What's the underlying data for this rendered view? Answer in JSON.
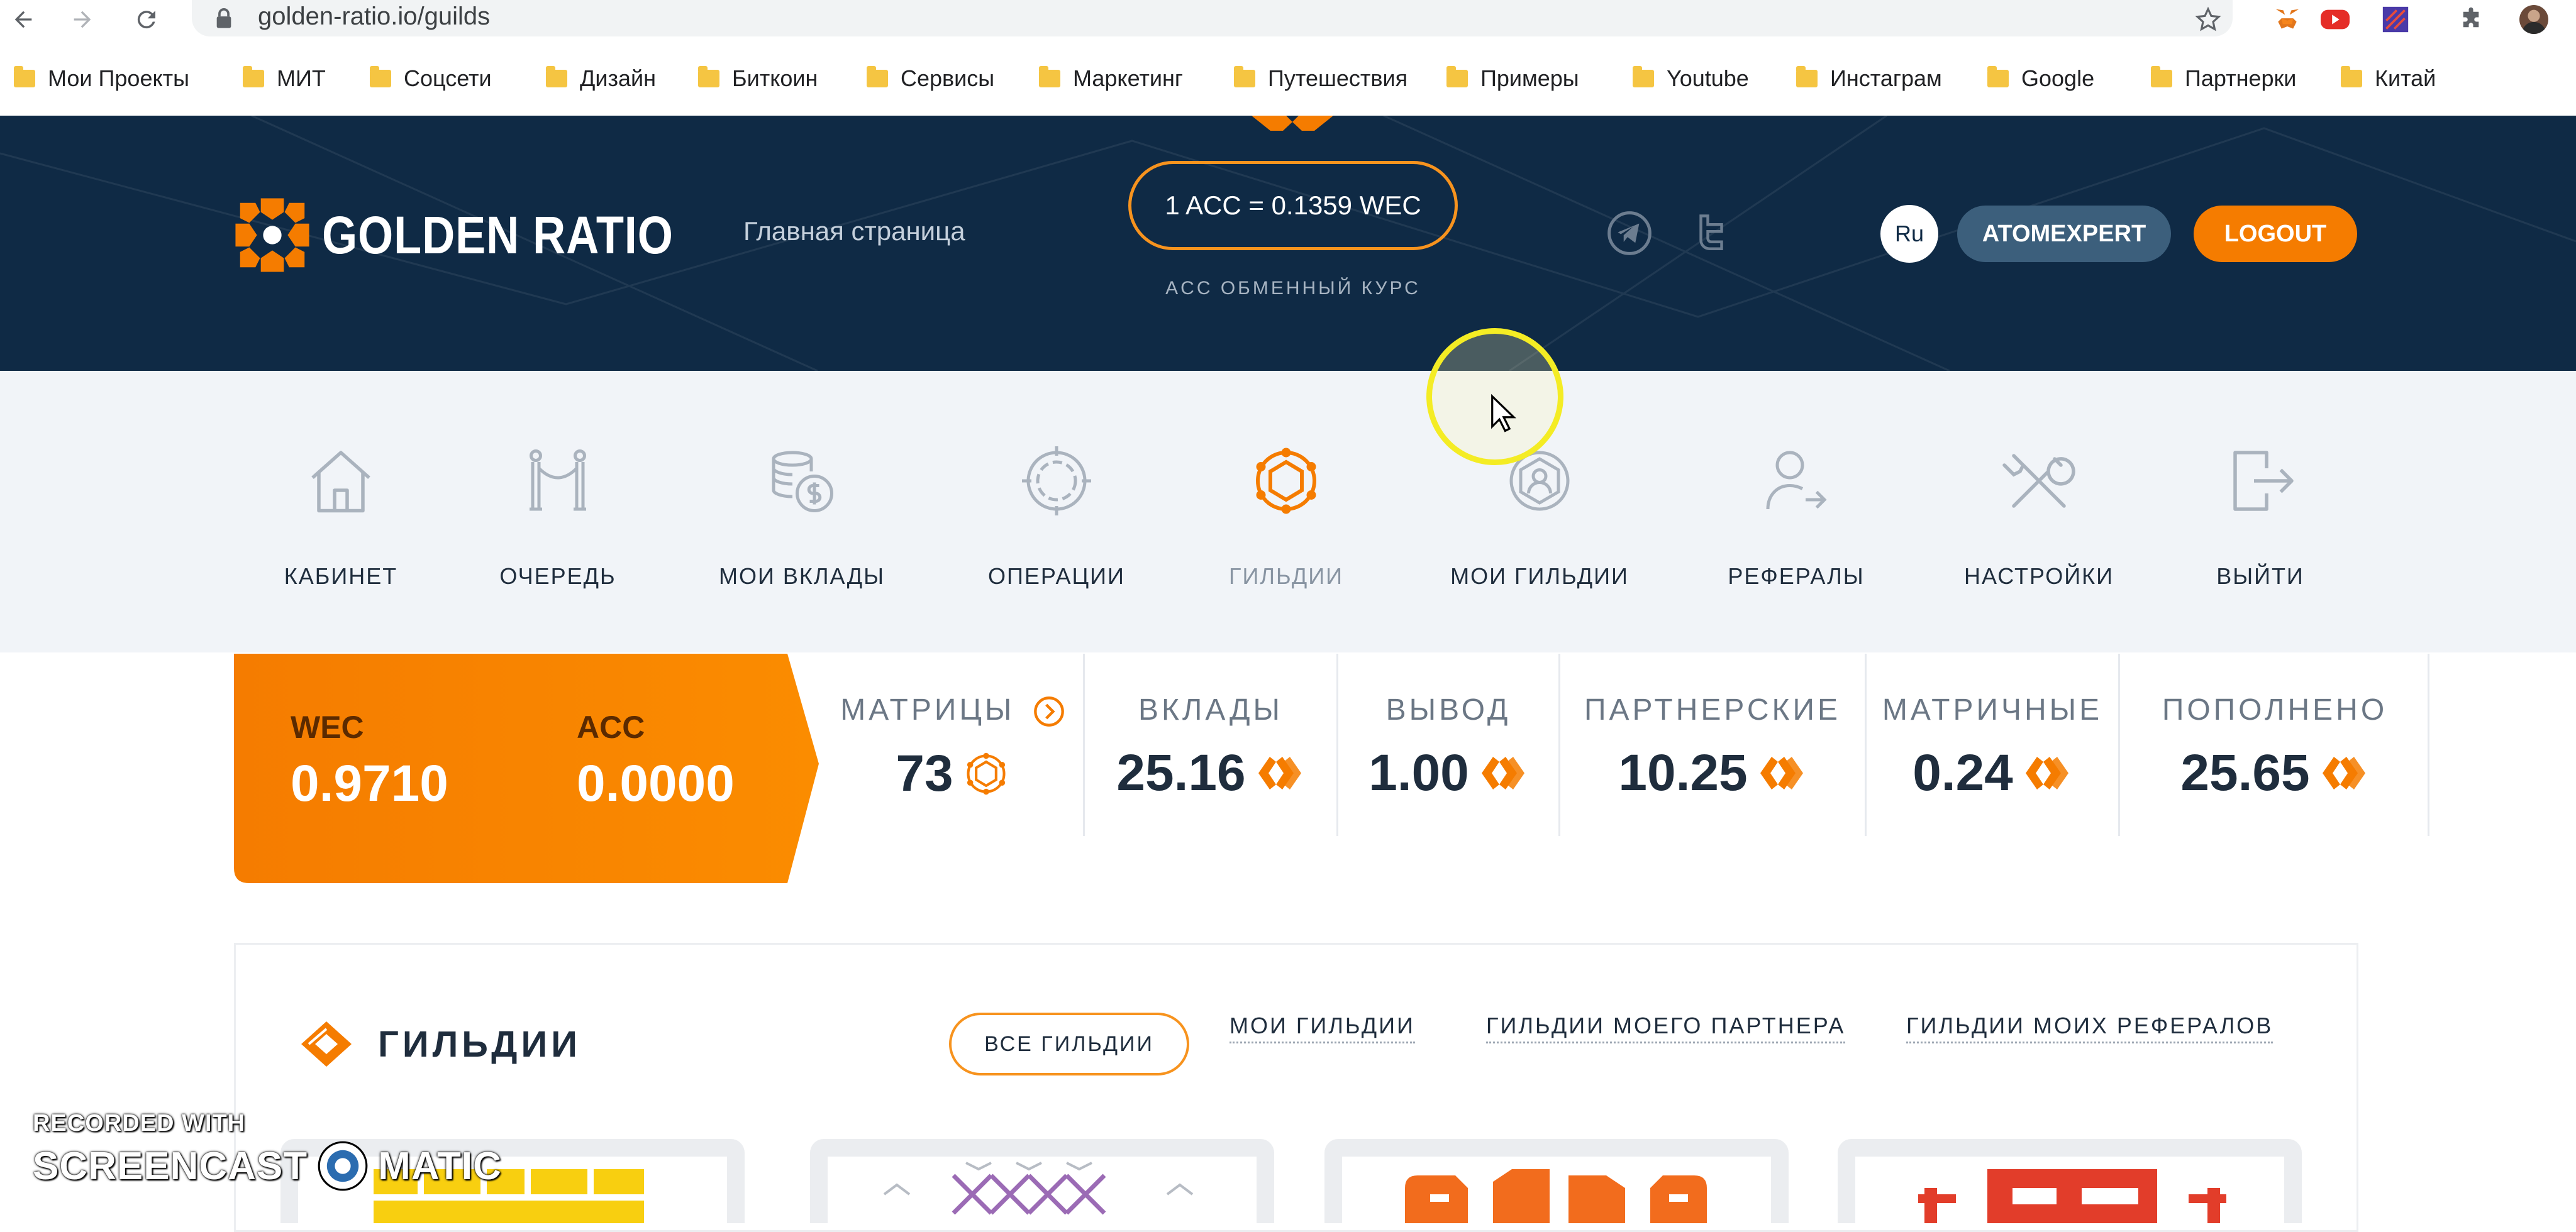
{
  "browser": {
    "url": "golden-ratio.io/guilds",
    "bookmarks": [
      "Мои Проекты",
      "МИТ",
      "Соцсети",
      "Дизайн",
      "Биткоин",
      "Сервисы",
      "Маркетинг",
      "Путешествия",
      "Примеры",
      "Youtube",
      "Инстаграм",
      "Google",
      "Партнерки",
      "Китай"
    ],
    "icons": [
      "back-arrow-icon",
      "forward-arrow-icon",
      "reload-icon",
      "lock-icon",
      "star-icon",
      "metamask-icon",
      "youtube-icon",
      "extension-icon",
      "puzzle-icon",
      "profile-avatar"
    ]
  },
  "header": {
    "logo_text": "GOLDEN RATIO",
    "home_link": "Главная страница",
    "rate": "1 ACC = 0.1359 WEC",
    "rate_caption": "ACC ОБМЕННЫЙ КУРС",
    "language": "Ru",
    "username": "ATOMEXPERT",
    "logout": "LOGOUT",
    "social_icons": [
      "telegram-icon",
      "twitter-icon"
    ]
  },
  "nav": {
    "items": [
      {
        "label": "КАБИНЕТ",
        "icon": "house-icon"
      },
      {
        "label": "ОЧЕРЕДЬ",
        "icon": "queue-posts-icon"
      },
      {
        "label": "МОИ ВКЛАДЫ",
        "icon": "coins-icon"
      },
      {
        "label": "ОПЕРАЦИИ",
        "icon": "operations-cycle-icon"
      },
      {
        "label": "ГИЛЬДИИ",
        "icon": "guild-network-icon"
      },
      {
        "label": "МОИ ГИЛЬДИИ",
        "icon": "my-guilds-icon"
      },
      {
        "label": "РЕФЕРАЛЫ",
        "icon": "referral-user-icon"
      },
      {
        "label": "НАСТРОЙКИ",
        "icon": "tools-icon"
      },
      {
        "label": "ВЫЙТИ",
        "icon": "exit-icon"
      }
    ],
    "active": "ГИЛЬДИИ"
  },
  "balances": {
    "wec": {
      "name": "WEC",
      "value": "0.9710"
    },
    "acc": {
      "name": "ACC",
      "value": "0.0000"
    }
  },
  "stats": [
    {
      "name": "МАТРИЦЫ",
      "value": "73"
    },
    {
      "name": "ВКЛАДЫ",
      "value": "25.16"
    },
    {
      "name": "ВЫВОД",
      "value": "1.00"
    },
    {
      "name": "ПАРТНЕРСКИЕ",
      "value": "10.25"
    },
    {
      "name": "МАТРИЧНЫЕ",
      "value": "0.24"
    },
    {
      "name": "ПОПОЛНЕНО",
      "value": "25.65"
    }
  ],
  "guilds": {
    "title": "ГИЛЬДИИ",
    "filters": [
      "ВСЕ ГИЛЬДИИ",
      "МОИ ГИЛЬДИИ",
      "ГИЛЬДИИ МОЕГО ПАРТНЕРА",
      "ГИЛЬДИИ МОИХ РЕФЕРАЛОВ"
    ],
    "active_filter": "ВСЕ ГИЛЬДИИ",
    "cards": [
      "yellow",
      "purple",
      "orange",
      "red"
    ]
  },
  "watermark": {
    "top": "RECORDED WITH",
    "left": "SCREENCAST",
    "right": "MATIC"
  },
  "colors": {
    "brand_orange": "#f57c00",
    "header_navy": "#0f2a45",
    "user_btn": "#3c5f7c",
    "nav_bg": "#f1f4f8"
  }
}
